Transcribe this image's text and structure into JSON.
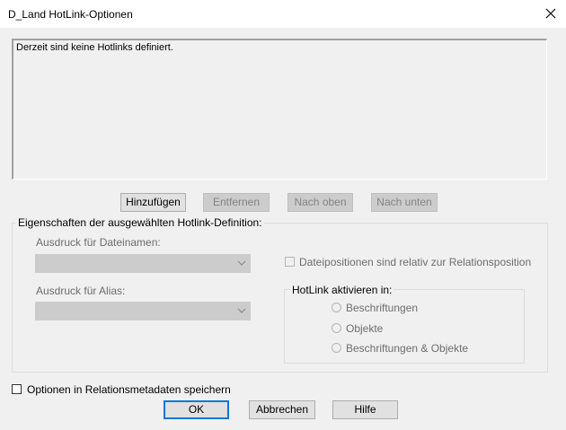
{
  "window": {
    "title": "D_Land HotLink-Optionen"
  },
  "hotlink_list": {
    "empty_text": "Derzeit sind keine Hotlinks definiert."
  },
  "list_buttons": {
    "add": "Hinzufügen",
    "remove": "Entfernen",
    "up": "Nach oben",
    "down": "Nach unten"
  },
  "properties": {
    "group_label": "Eigenschaften der ausgewählten Hotlink-Definition:",
    "filename_label": "Ausdruck für Dateinamen:",
    "filename_value": "",
    "alias_label": "Ausdruck für Alias:",
    "alias_value": "",
    "relative_positions_label": "Dateipositionen sind relativ zur Relationsposition",
    "relative_positions_checked": false,
    "activate_group_label": "HotLink aktivieren in:",
    "activate_options": [
      "Beschriftungen",
      "Objekte",
      "Beschriftungen & Objekte"
    ]
  },
  "save_in_metadata": {
    "label": "Optionen in Relationsmetadaten speichern",
    "checked": false
  },
  "dialog_buttons": {
    "ok": "OK",
    "cancel": "Abbrechen",
    "help": "Hilfe"
  },
  "colors": {
    "accent": "#0078d7",
    "disabled_fill": "#cccccc",
    "background": "#f0f0f0"
  }
}
